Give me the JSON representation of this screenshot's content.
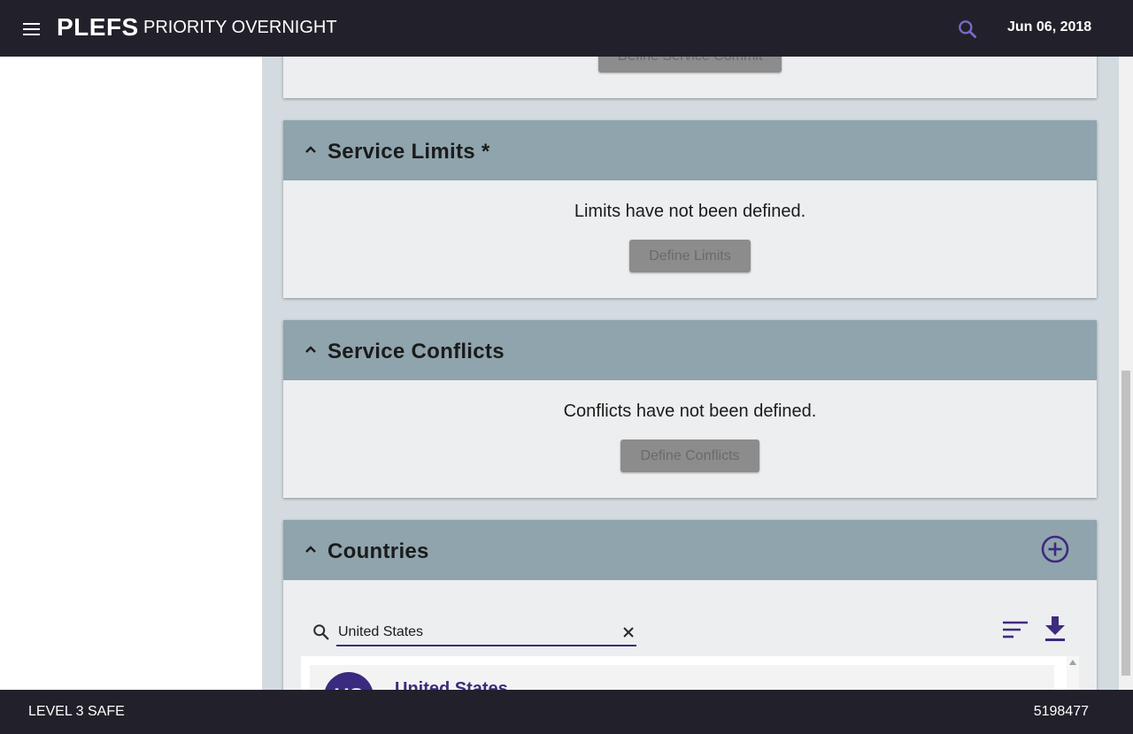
{
  "header": {
    "brand": "PLEFS",
    "subtitle": "PRIORITY OVERNIGHT",
    "date": "Jun 06, 2018"
  },
  "panels": {
    "service_commit": {
      "button_label": "Define Service Commit"
    },
    "service_limits": {
      "title": "Service Limits *",
      "message": "Limits have not been defined.",
      "button_label": "Define Limits"
    },
    "service_conflicts": {
      "title": "Service Conflicts",
      "message": "Conflicts have not been defined.",
      "button_label": "Define Conflicts"
    },
    "countries": {
      "title": "Countries",
      "search_value": "United States",
      "items": [
        {
          "avatar_text": "US",
          "name": "United States"
        }
      ]
    }
  },
  "footer": {
    "level": "LEVEL 3 SAFE",
    "id": "5198477"
  },
  "colors": {
    "topbar": "#22202a",
    "panel_header": "#8fa4ad",
    "content_bg": "#d3dbe0",
    "accent": "#3f2a7d"
  }
}
